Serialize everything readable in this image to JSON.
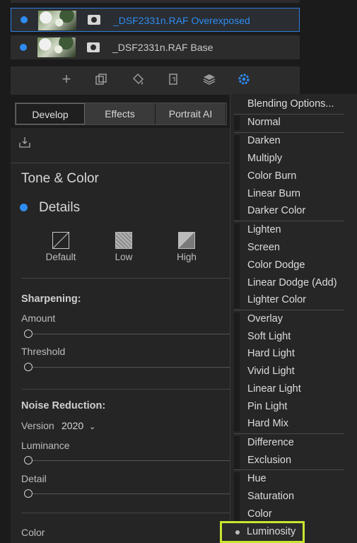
{
  "layers": [
    {
      "name": "_DSF2331n.RAF Overexposed",
      "selected": true,
      "color": "#2f8cf3"
    },
    {
      "name": "_DSF2331n.RAF Base",
      "selected": false,
      "color": "#c9c9c9"
    }
  ],
  "toolbar": {
    "icons": [
      "add-layer-icon",
      "duplicate-layer-icon",
      "fill-bucket-icon",
      "mask-icon",
      "stack-layers-icon",
      "gear-icon"
    ]
  },
  "tabs": [
    "Develop",
    "Effects",
    "Portrait AI"
  ],
  "panel": {
    "section_title": "Tone & Color",
    "details_title": "Details",
    "presets": [
      "Default",
      "Low",
      "High"
    ],
    "sharpening": {
      "title": "Sharpening:",
      "amount_label": "Amount",
      "threshold_label": "Threshold",
      "amount_value": 0,
      "threshold_value": 0
    },
    "noise": {
      "title": "Noise Reduction:",
      "version_label": "Version",
      "version_value": "2020",
      "luminance_label": "Luminance",
      "detail_label": "Detail",
      "luminance_value": 0,
      "detail_value": 0
    },
    "color_label": "Color"
  },
  "blend_menu": {
    "items": [
      "Blending Options...",
      "Normal",
      "Darken",
      "Multiply",
      "Color Burn",
      "Linear Burn",
      "Darker Color",
      "Lighten",
      "Screen",
      "Color Dodge",
      "Linear Dodge (Add)",
      "Lighter Color",
      "Overlay",
      "Soft Light",
      "Hard Light",
      "Vivid Light",
      "Linear Light",
      "Pin Light",
      "Hard Mix",
      "Difference",
      "Exclusion",
      "Hue",
      "Saturation",
      "Color",
      "Luminosity"
    ],
    "selected": "Luminosity",
    "highlight_color": "#c8e630"
  }
}
